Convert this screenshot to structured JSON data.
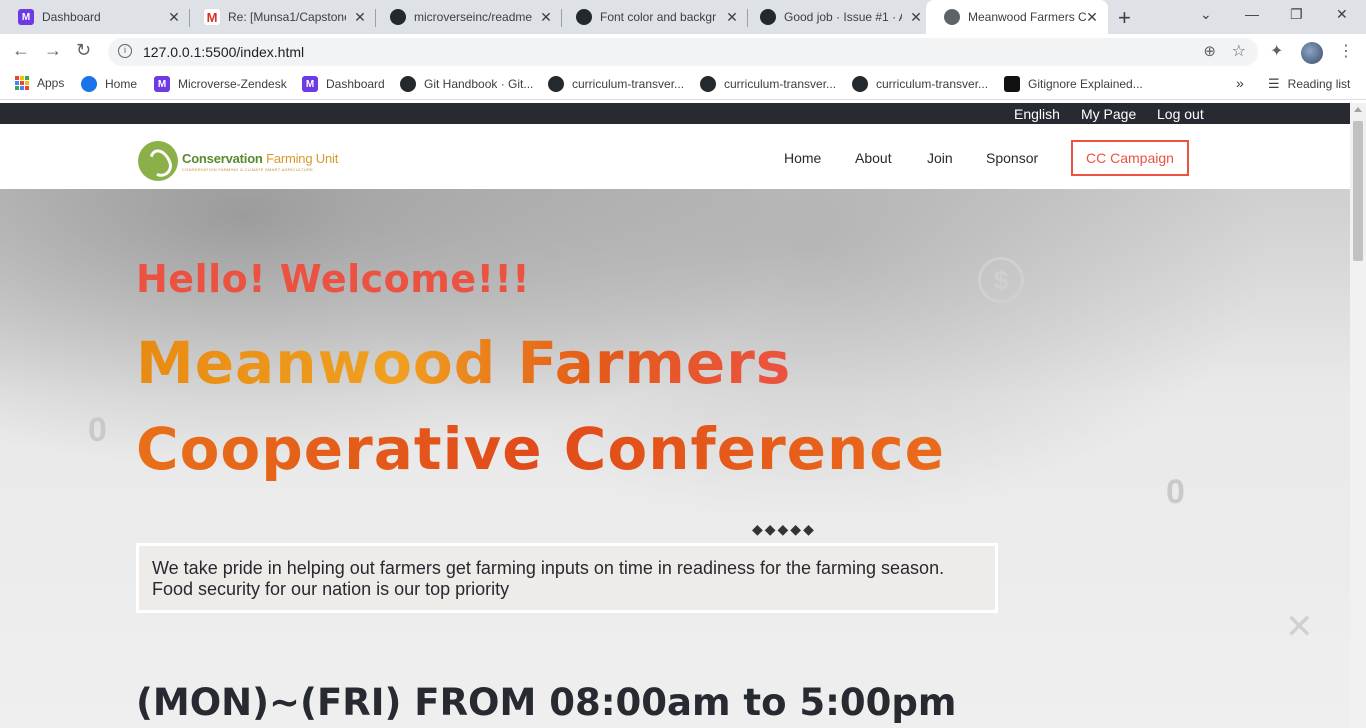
{
  "browser": {
    "tabs": [
      {
        "title": "Dashboard",
        "icon": "microverse-icon"
      },
      {
        "title": "Re: [Munsa1/Capstone",
        "icon": "gmail-icon"
      },
      {
        "title": "microverseinc/readme",
        "icon": "github-icon"
      },
      {
        "title": "Font color and backgr",
        "icon": "github-icon"
      },
      {
        "title": "Good job · Issue #1 · A",
        "icon": "github-icon"
      },
      {
        "title": "Meanwood Farmers Co",
        "icon": "globe-icon",
        "active": true
      }
    ],
    "url": "127.0.0.1:5500/index.html",
    "bookmarks": [
      {
        "label": "Apps",
        "icon": "apps-icon"
      },
      {
        "label": "Home",
        "icon": "un-icon"
      },
      {
        "label": "Microverse-Zendesk",
        "icon": "microverse-icon"
      },
      {
        "label": "Dashboard",
        "icon": "microverse-icon"
      },
      {
        "label": "Git Handbook · Git...",
        "icon": "github-icon"
      },
      {
        "label": "curriculum-transver...",
        "icon": "github-icon"
      },
      {
        "label": "curriculum-transver...",
        "icon": "github-icon"
      },
      {
        "label": "curriculum-transver...",
        "icon": "github-icon"
      },
      {
        "label": "Gitignore Explained...",
        "icon": "gitignore-icon"
      }
    ],
    "bookmarks_overflow": "»",
    "reading_list": "Reading list"
  },
  "page": {
    "topbar": {
      "english": "English",
      "my_page": "My Page",
      "logout": "Log out"
    },
    "logo": {
      "name_part1": "Conservation ",
      "name_part2": "Farming Unit",
      "tagline": "CONSERVATION FARMING & CLIMATE SMART AGRICULTURE"
    },
    "nav": {
      "home": "Home",
      "about": "About",
      "join": "Join",
      "sponsor": "Sponsor",
      "campaign": "CC Campaign"
    },
    "hero": {
      "greeting": "Hello! Welcome!!!",
      "title_line1": "Meanwood Farmers",
      "title_line2": "Cooperative Conference",
      "description": "We take pride in helping out farmers get farming inputs on time in readiness for the farming season. Food security for our nation is our top priority",
      "schedule": "(MON)~(FRI) FROM 08:00am to 5:00pm"
    }
  },
  "colors": {
    "accent": "#ec5242",
    "dark": "#272a31",
    "text_gradient_start": "#e88a12"
  }
}
